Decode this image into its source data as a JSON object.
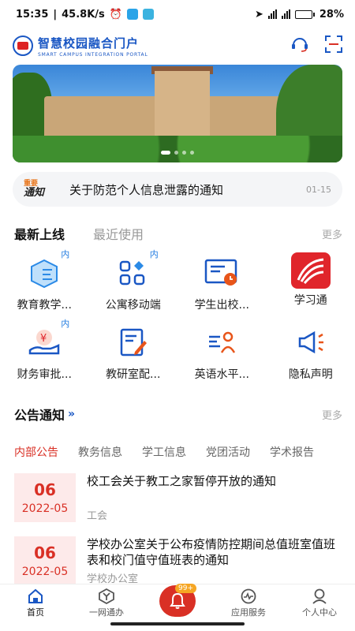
{
  "status": {
    "time": "15:35",
    "speed": "45.8K/s",
    "battery": "28%",
    "battery_level": 0.28
  },
  "header": {
    "title": "智慧校园融合门户",
    "subtitle": "SMART CAMPUS INTEGRATION PORTAL"
  },
  "notice": {
    "badge_top": "重要",
    "badge_bottom": "通知",
    "text": "关于防范个人信息泄露的通知",
    "date": "01-15"
  },
  "apps_section": {
    "tab_new": "最新上线",
    "tab_recent": "最近使用",
    "more": "更多",
    "items": [
      {
        "label": "教育教学...",
        "icon": "education-cube-icon",
        "badge": "内"
      },
      {
        "label": "公寓移动端",
        "icon": "apartment-grid-icon",
        "badge": "内"
      },
      {
        "label": "学生出校...",
        "icon": "student-exit-clock-icon",
        "badge": ""
      },
      {
        "label": "学习通",
        "icon": "xuexitong-logo-icon",
        "badge": ""
      },
      {
        "label": "财务审批...",
        "icon": "finance-yuan-hand-icon",
        "badge": "内"
      },
      {
        "label": "教研室配...",
        "icon": "edit-document-icon",
        "badge": ""
      },
      {
        "label": "英语水平...",
        "icon": "english-person-icon",
        "badge": ""
      },
      {
        "label": "隐私声明",
        "icon": "megaphone-icon",
        "badge": ""
      }
    ]
  },
  "announcement": {
    "title": "公告通知",
    "more": "更多",
    "tabs": [
      "内部公告",
      "教务信息",
      "学工信息",
      "党团活动",
      "学术报告"
    ],
    "items": [
      {
        "day": "06",
        "month": "2022-05",
        "title": "校工会关于教工之家暂停开放的通知",
        "dept": "工会"
      },
      {
        "day": "06",
        "month": "2022-05",
        "title": "学校办公室关于公布疫情防控期间总值班室值班表和校门值守值班表的通知",
        "dept": "学校办公室"
      }
    ]
  },
  "bottom_nav": {
    "home": "首页",
    "onestop": "一网通办",
    "bell_badge": "99+",
    "services": "应用服务",
    "profile": "个人中心"
  },
  "colors": {
    "accent_red": "#d93025",
    "brand_blue": "#1a57c4"
  }
}
